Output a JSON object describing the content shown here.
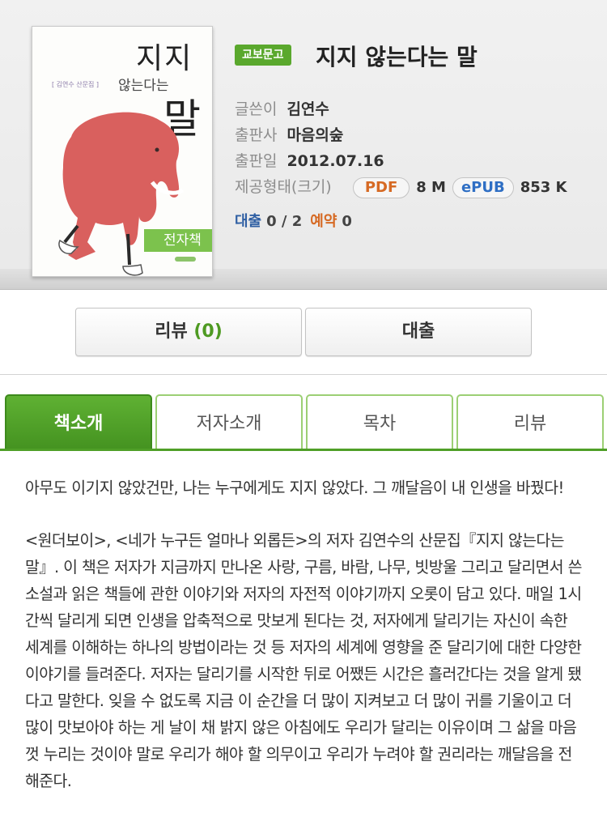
{
  "cover": {
    "title_line1": "지지",
    "title_line2": "않는다는",
    "title_line3": "말",
    "author_tag": "[ 김연수 산문집 ]",
    "ebook_badge": "전자책"
  },
  "book": {
    "series_badge": "교보문고",
    "title": "지지 않는다는 말"
  },
  "meta": {
    "author_label": "글쓴이",
    "author": "김연수",
    "publisher_label": "출판사",
    "publisher": "마음의숲",
    "date_label": "출판일",
    "date": "2012.07.16",
    "format_label": "제공형태(크기)",
    "formats": [
      {
        "name": "PDF",
        "size": "8 M",
        "color": "#d66a24"
      },
      {
        "name": "ePUB",
        "size": "853 K",
        "color": "#2f6fc4"
      }
    ]
  },
  "availability": {
    "loan_label": "대출",
    "loan_value": "0 / 2",
    "reserve_label": "예약",
    "reserve_value": "0"
  },
  "actions": {
    "review_label": "리뷰",
    "review_count": "(0)",
    "loan_label": "대출"
  },
  "tabs": [
    {
      "label": "책소개",
      "active": true
    },
    {
      "label": "저자소개",
      "active": false
    },
    {
      "label": "목차",
      "active": false
    },
    {
      "label": "리뷰",
      "active": false
    }
  ],
  "description": {
    "para1": "아무도 이기지 않았건만, 나는 누구에게도 지지 않았다. 그 깨달음이 내 인생을 바꿨다!",
    "para2": "<원더보이>, <네가 누구든 얼마나 외롭든>의 저자 김연수의 산문집『지지 않는다는 말』. 이 책은 저자가 지금까지 만나온 사랑, 구름, 바람, 나무, 빗방울 그리고 달리면서 쓴 소설과 읽은 책들에 관한 이야기와 저자의 자전적 이야기까지 오롯이 담고 있다. 매일 1시간씩 달리게 되면 인생을 압축적으로 맛보게 된다는 것, 저자에게 달리기는 자신이 속한 세계를 이해하는 하나의 방법이라는 것 등 저자의 세계에 영향을 준 달리기에 대한 다양한 이야기를 들려준다. 저자는 달리기를 시작한 뒤로 어쨌든 시간은 흘러간다는 것을 알게 됐다고 말한다. 잊을 수 없도록 지금 이 순간을 더 많이 지켜보고 더 많이 귀를 기울이고 더 많이 맛보아야 하는 게 날이 채 밝지 않은 아침에도 우리가 달리는 이유이며 그 삶을 마음껏 누리는 것이야 말로 우리가 해야 할 의무이고 우리가 누려야 할 권리라는 깨달음을 전해준다."
  }
}
